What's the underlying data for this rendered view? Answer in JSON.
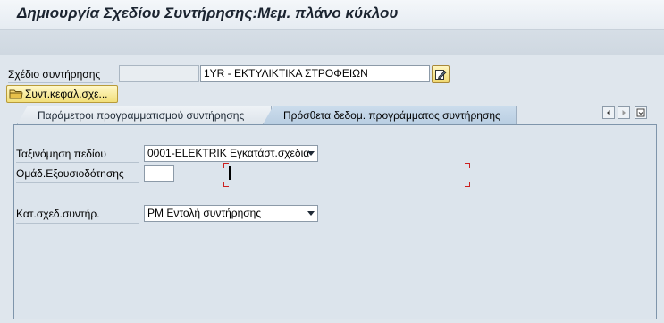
{
  "window": {
    "title": "Δημιουργία Σχεδίου Συντήρησης:Μεμ. πλάνο κύκλου"
  },
  "header": {
    "plan_label": "Σχέδιο συντήρησης",
    "plan_number": "",
    "plan_description": "1YR - ΕΚΤΥΛΙΚΤΙΚΑ ΣΤΡΟΦΕΙΩΝ",
    "header_button_label": "Συντ.κεφαλ.σχε...",
    "edit_icon": "pencil-edit-icon",
    "header_button_icon": "folder-header-icon"
  },
  "tabs": [
    {
      "label": "Παράμετροι προγραμματισμού συντήρησης",
      "active": false
    },
    {
      "label": "Πρόσθετα δεδομ. προγράμματος συντήρησης",
      "active": true
    }
  ],
  "tab_nav": {
    "left_icon": "scroll-left-icon",
    "right_icon": "scroll-right-icon",
    "list_icon": "tab-list-icon"
  },
  "form": {
    "sort_field_label": "Ταξινόμηση πεδίου",
    "sort_field_value": "0001-ELEKTRIK Εγκατάστ.σχεδια",
    "auth_group_label": "Ομάδ.Εξουσιοδότησης",
    "auth_group_value": "",
    "category_label": "Κατ.σχεδ.συντήρ.",
    "category_value": "PM Εντολή συντήρησης"
  },
  "colors": {
    "background": "#dfe6ed",
    "active_tab": "#c4d6e8",
    "button_yellow": "#f5e69a",
    "cursor_bracket": "#cc2020"
  }
}
